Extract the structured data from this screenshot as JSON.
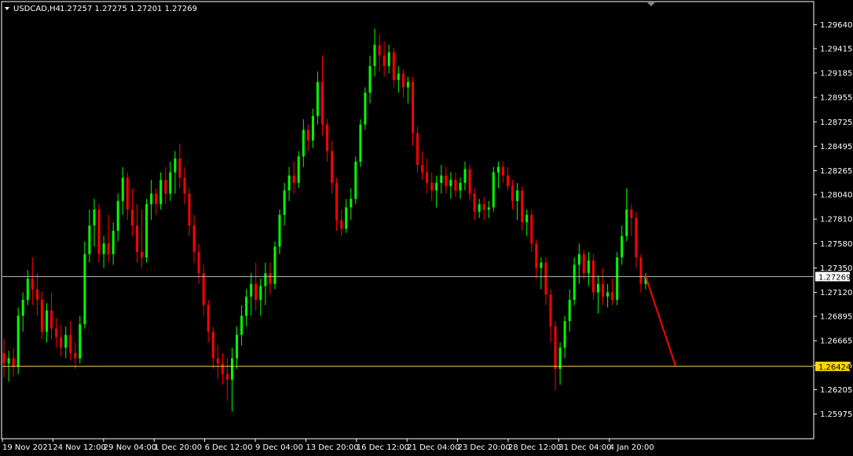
{
  "header": {
    "symbol": "USDCAD,H4",
    "ohlc": "1.27257 1.27275 1.27201 1.27269"
  },
  "colors": {
    "background": "#000000",
    "frame": "#ffffff",
    "bull": "#00ff00",
    "bear": "#ff0000",
    "price_line": "#c0c0c0",
    "support_line": "#ffd75a",
    "support_tag": "#ffd700",
    "arrow": "#ff0000"
  },
  "chart_data": {
    "type": "candlestick",
    "title": "USDCAD,H4",
    "ylim": [
      1.2575,
      1.2985
    ],
    "y_ticks": [
      "1.29640",
      "1.29415",
      "1.29185",
      "1.28955",
      "1.28725",
      "1.28495",
      "1.28265",
      "1.28040",
      "1.27810",
      "1.27580",
      "1.27350",
      "1.27120",
      "1.26895",
      "1.26665",
      "1.26435",
      "1.26205",
      "1.25975"
    ],
    "x_ticks": [
      "19 Nov 2021",
      "24 Nov 12:00",
      "29 Nov 04:00",
      "1 Dec 20:00",
      "6 Dec 12:00",
      "9 Dec 04:00",
      "13 Dec 20:00",
      "16 Dec 12:00",
      "21 Dec 04:00",
      "23 Dec 20:00",
      "28 Dec 12:00",
      "31 Dec 04:00",
      "4 Jan 20:00"
    ],
    "current_price": {
      "value": 1.27269,
      "label": "1.27269"
    },
    "support_level": {
      "value": 1.26424,
      "label": "1.26424"
    },
    "forecast_arrow": {
      "from": 1.2727,
      "to": 1.2643
    },
    "series": [
      {
        "o": 1.2655,
        "h": 1.2668,
        "l": 1.2632,
        "c": 1.2645
      },
      {
        "o": 1.2645,
        "h": 1.2657,
        "l": 1.2628,
        "c": 1.265
      },
      {
        "o": 1.265,
        "h": 1.266,
        "l": 1.2633,
        "c": 1.2642
      },
      {
        "o": 1.2642,
        "h": 1.2698,
        "l": 1.2635,
        "c": 1.269
      },
      {
        "o": 1.269,
        "h": 1.2712,
        "l": 1.2675,
        "c": 1.2705
      },
      {
        "o": 1.2705,
        "h": 1.2733,
        "l": 1.27,
        "c": 1.2725
      },
      {
        "o": 1.2725,
        "h": 1.2745,
        "l": 1.27,
        "c": 1.2715
      },
      {
        "o": 1.2715,
        "h": 1.273,
        "l": 1.269,
        "c": 1.2705
      },
      {
        "o": 1.2705,
        "h": 1.2713,
        "l": 1.2668,
        "c": 1.2675
      },
      {
        "o": 1.2675,
        "h": 1.2702,
        "l": 1.2665,
        "c": 1.2695
      },
      {
        "o": 1.2695,
        "h": 1.2712,
        "l": 1.2668,
        "c": 1.2678
      },
      {
        "o": 1.2678,
        "h": 1.2688,
        "l": 1.266,
        "c": 1.267
      },
      {
        "o": 1.267,
        "h": 1.2682,
        "l": 1.2652,
        "c": 1.266
      },
      {
        "o": 1.266,
        "h": 1.268,
        "l": 1.265,
        "c": 1.2672
      },
      {
        "o": 1.2672,
        "h": 1.2685,
        "l": 1.2648,
        "c": 1.2655
      },
      {
        "o": 1.2655,
        "h": 1.2665,
        "l": 1.264,
        "c": 1.265
      },
      {
        "o": 1.265,
        "h": 1.269,
        "l": 1.2645,
        "c": 1.2682
      },
      {
        "o": 1.2682,
        "h": 1.276,
        "l": 1.2678,
        "c": 1.2748
      },
      {
        "o": 1.2748,
        "h": 1.279,
        "l": 1.274,
        "c": 1.2775
      },
      {
        "o": 1.2775,
        "h": 1.28,
        "l": 1.2755,
        "c": 1.279
      },
      {
        "o": 1.279,
        "h": 1.2795,
        "l": 1.274,
        "c": 1.2748
      },
      {
        "o": 1.2748,
        "h": 1.2765,
        "l": 1.2735,
        "c": 1.2758
      },
      {
        "o": 1.2758,
        "h": 1.2785,
        "l": 1.274,
        "c": 1.2748
      },
      {
        "o": 1.2748,
        "h": 1.2778,
        "l": 1.2738,
        "c": 1.277
      },
      {
        "o": 1.277,
        "h": 1.2805,
        "l": 1.276,
        "c": 1.2798
      },
      {
        "o": 1.2798,
        "h": 1.283,
        "l": 1.2785,
        "c": 1.282
      },
      {
        "o": 1.282,
        "h": 1.2825,
        "l": 1.278,
        "c": 1.279
      },
      {
        "o": 1.279,
        "h": 1.281,
        "l": 1.2765,
        "c": 1.2775
      },
      {
        "o": 1.2775,
        "h": 1.2795,
        "l": 1.274,
        "c": 1.275
      },
      {
        "o": 1.275,
        "h": 1.279,
        "l": 1.2735,
        "c": 1.2745
      },
      {
        "o": 1.2745,
        "h": 1.28,
        "l": 1.274,
        "c": 1.2795
      },
      {
        "o": 1.2795,
        "h": 1.2818,
        "l": 1.278,
        "c": 1.2805
      },
      {
        "o": 1.2805,
        "h": 1.281,
        "l": 1.2785,
        "c": 1.2795
      },
      {
        "o": 1.2795,
        "h": 1.2825,
        "l": 1.279,
        "c": 1.2818
      },
      {
        "o": 1.2818,
        "h": 1.283,
        "l": 1.2795,
        "c": 1.2805
      },
      {
        "o": 1.2805,
        "h": 1.2835,
        "l": 1.2798,
        "c": 1.2825
      },
      {
        "o": 1.2825,
        "h": 1.2845,
        "l": 1.2805,
        "c": 1.2838
      },
      {
        "o": 1.2838,
        "h": 1.2852,
        "l": 1.281,
        "c": 1.282
      },
      {
        "o": 1.282,
        "h": 1.283,
        "l": 1.2795,
        "c": 1.2805
      },
      {
        "o": 1.2805,
        "h": 1.281,
        "l": 1.2765,
        "c": 1.2775
      },
      {
        "o": 1.2775,
        "h": 1.2785,
        "l": 1.274,
        "c": 1.275
      },
      {
        "o": 1.275,
        "h": 1.2758,
        "l": 1.272,
        "c": 1.273
      },
      {
        "o": 1.273,
        "h": 1.2738,
        "l": 1.269,
        "c": 1.27
      },
      {
        "o": 1.27,
        "h": 1.2705,
        "l": 1.2665,
        "c": 1.2675
      },
      {
        "o": 1.2675,
        "h": 1.268,
        "l": 1.264,
        "c": 1.265
      },
      {
        "o": 1.265,
        "h": 1.2662,
        "l": 1.263,
        "c": 1.2645
      },
      {
        "o": 1.2645,
        "h": 1.2655,
        "l": 1.2625,
        "c": 1.2635
      },
      {
        "o": 1.2635,
        "h": 1.265,
        "l": 1.261,
        "c": 1.263
      },
      {
        "o": 1.263,
        "h": 1.266,
        "l": 1.26,
        "c": 1.265
      },
      {
        "o": 1.265,
        "h": 1.268,
        "l": 1.264,
        "c": 1.2672
      },
      {
        "o": 1.2672,
        "h": 1.27,
        "l": 1.2662,
        "c": 1.269
      },
      {
        "o": 1.269,
        "h": 1.2715,
        "l": 1.268,
        "c": 1.2708
      },
      {
        "o": 1.2708,
        "h": 1.273,
        "l": 1.269,
        "c": 1.272
      },
      {
        "o": 1.272,
        "h": 1.274,
        "l": 1.2695,
        "c": 1.2705
      },
      {
        "o": 1.2705,
        "h": 1.2725,
        "l": 1.269,
        "c": 1.2718
      },
      {
        "o": 1.2718,
        "h": 1.274,
        "l": 1.27,
        "c": 1.273
      },
      {
        "o": 1.273,
        "h": 1.274,
        "l": 1.271,
        "c": 1.272
      },
      {
        "o": 1.272,
        "h": 1.276,
        "l": 1.2715,
        "c": 1.2755
      },
      {
        "o": 1.2755,
        "h": 1.279,
        "l": 1.2748,
        "c": 1.2785
      },
      {
        "o": 1.2785,
        "h": 1.2815,
        "l": 1.2775,
        "c": 1.2808
      },
      {
        "o": 1.2808,
        "h": 1.283,
        "l": 1.2798,
        "c": 1.2822
      },
      {
        "o": 1.2822,
        "h": 1.2835,
        "l": 1.2805,
        "c": 1.2815
      },
      {
        "o": 1.2815,
        "h": 1.2845,
        "l": 1.281,
        "c": 1.284
      },
      {
        "o": 1.284,
        "h": 1.2875,
        "l": 1.283,
        "c": 1.2865
      },
      {
        "o": 1.2865,
        "h": 1.287,
        "l": 1.2845,
        "c": 1.2855
      },
      {
        "o": 1.2855,
        "h": 1.2885,
        "l": 1.2848,
        "c": 1.2878
      },
      {
        "o": 1.2878,
        "h": 1.292,
        "l": 1.287,
        "c": 1.291
      },
      {
        "o": 1.291,
        "h": 1.2935,
        "l": 1.286,
        "c": 1.287
      },
      {
        "o": 1.287,
        "h": 1.2875,
        "l": 1.2835,
        "c": 1.2845
      },
      {
        "o": 1.2845,
        "h": 1.2855,
        "l": 1.2805,
        "c": 1.2815
      },
      {
        "o": 1.2815,
        "h": 1.282,
        "l": 1.277,
        "c": 1.278
      },
      {
        "o": 1.278,
        "h": 1.279,
        "l": 1.2765,
        "c": 1.2772
      },
      {
        "o": 1.2772,
        "h": 1.28,
        "l": 1.2768,
        "c": 1.2792
      },
      {
        "o": 1.2792,
        "h": 1.281,
        "l": 1.278,
        "c": 1.28
      },
      {
        "o": 1.28,
        "h": 1.284,
        "l": 1.2795,
        "c": 1.2835
      },
      {
        "o": 1.2835,
        "h": 1.2875,
        "l": 1.283,
        "c": 1.287
      },
      {
        "o": 1.287,
        "h": 1.2905,
        "l": 1.2865,
        "c": 1.29
      },
      {
        "o": 1.29,
        "h": 1.2935,
        "l": 1.289,
        "c": 1.2925
      },
      {
        "o": 1.2925,
        "h": 1.296,
        "l": 1.2915,
        "c": 1.2945
      },
      {
        "o": 1.2945,
        "h": 1.2955,
        "l": 1.292,
        "c": 1.2935
      },
      {
        "o": 1.2935,
        "h": 1.2948,
        "l": 1.2915,
        "c": 1.2925
      },
      {
        "o": 1.2925,
        "h": 1.2945,
        "l": 1.2918,
        "c": 1.2938
      },
      {
        "o": 1.2938,
        "h": 1.2942,
        "l": 1.2905,
        "c": 1.2912
      },
      {
        "o": 1.2912,
        "h": 1.2925,
        "l": 1.29,
        "c": 1.2918
      },
      {
        "o": 1.2918,
        "h": 1.2922,
        "l": 1.2895,
        "c": 1.2905
      },
      {
        "o": 1.2905,
        "h": 1.2915,
        "l": 1.289,
        "c": 1.291
      },
      {
        "o": 1.291,
        "h": 1.2915,
        "l": 1.285,
        "c": 1.2862
      },
      {
        "o": 1.2862,
        "h": 1.2868,
        "l": 1.2825,
        "c": 1.2832
      },
      {
        "o": 1.2832,
        "h": 1.2845,
        "l": 1.2818,
        "c": 1.2825
      },
      {
        "o": 1.2825,
        "h": 1.2838,
        "l": 1.2805,
        "c": 1.2815
      },
      {
        "o": 1.2815,
        "h": 1.2825,
        "l": 1.2798,
        "c": 1.2808
      },
      {
        "o": 1.2808,
        "h": 1.2822,
        "l": 1.2792,
        "c": 1.2815
      },
      {
        "o": 1.2815,
        "h": 1.2832,
        "l": 1.2805,
        "c": 1.2822
      },
      {
        "o": 1.2822,
        "h": 1.283,
        "l": 1.2805,
        "c": 1.2812
      },
      {
        "o": 1.2812,
        "h": 1.2825,
        "l": 1.28,
        "c": 1.2818
      },
      {
        "o": 1.2818,
        "h": 1.2825,
        "l": 1.2802,
        "c": 1.2808
      },
      {
        "o": 1.2808,
        "h": 1.282,
        "l": 1.28,
        "c": 1.2815
      },
      {
        "o": 1.2815,
        "h": 1.2835,
        "l": 1.2808,
        "c": 1.2828
      },
      {
        "o": 1.2828,
        "h": 1.2832,
        "l": 1.2798,
        "c": 1.2805
      },
      {
        "o": 1.2805,
        "h": 1.281,
        "l": 1.278,
        "c": 1.2788
      },
      {
        "o": 1.2788,
        "h": 1.28,
        "l": 1.2782,
        "c": 1.2795
      },
      {
        "o": 1.2795,
        "h": 1.2802,
        "l": 1.278,
        "c": 1.279
      },
      {
        "o": 1.279,
        "h": 1.2798,
        "l": 1.2782,
        "c": 1.2792
      },
      {
        "o": 1.2792,
        "h": 1.283,
        "l": 1.2788,
        "c": 1.2825
      },
      {
        "o": 1.2825,
        "h": 1.2835,
        "l": 1.281,
        "c": 1.283
      },
      {
        "o": 1.283,
        "h": 1.2835,
        "l": 1.2815,
        "c": 1.2822
      },
      {
        "o": 1.2822,
        "h": 1.283,
        "l": 1.2808,
        "c": 1.2812
      },
      {
        "o": 1.2812,
        "h": 1.2818,
        "l": 1.279,
        "c": 1.2798
      },
      {
        "o": 1.2798,
        "h": 1.2815,
        "l": 1.278,
        "c": 1.2808
      },
      {
        "o": 1.2808,
        "h": 1.2812,
        "l": 1.277,
        "c": 1.2778
      },
      {
        "o": 1.2778,
        "h": 1.279,
        "l": 1.2765,
        "c": 1.2785
      },
      {
        "o": 1.2785,
        "h": 1.279,
        "l": 1.275,
        "c": 1.2758
      },
      {
        "o": 1.2758,
        "h": 1.2762,
        "l": 1.2725,
        "c": 1.2735
      },
      {
        "o": 1.2735,
        "h": 1.2745,
        "l": 1.2715,
        "c": 1.274
      },
      {
        "o": 1.274,
        "h": 1.2745,
        "l": 1.27,
        "c": 1.271
      },
      {
        "o": 1.271,
        "h": 1.2715,
        "l": 1.2665,
        "c": 1.268
      },
      {
        "o": 1.268,
        "h": 1.2685,
        "l": 1.262,
        "c": 1.264
      },
      {
        "o": 1.264,
        "h": 1.2665,
        "l": 1.2625,
        "c": 1.266
      },
      {
        "o": 1.266,
        "h": 1.269,
        "l": 1.265,
        "c": 1.2685
      },
      {
        "o": 1.2685,
        "h": 1.2715,
        "l": 1.2675,
        "c": 1.2705
      },
      {
        "o": 1.2705,
        "h": 1.2745,
        "l": 1.27,
        "c": 1.2738
      },
      {
        "o": 1.2738,
        "h": 1.2758,
        "l": 1.272,
        "c": 1.2748
      },
      {
        "o": 1.2748,
        "h": 1.2752,
        "l": 1.2725,
        "c": 1.273
      },
      {
        "o": 1.273,
        "h": 1.275,
        "l": 1.2718,
        "c": 1.2742
      },
      {
        "o": 1.2742,
        "h": 1.2748,
        "l": 1.2705,
        "c": 1.2712
      },
      {
        "o": 1.2712,
        "h": 1.2728,
        "l": 1.2692,
        "c": 1.272
      },
      {
        "o": 1.272,
        "h": 1.2735,
        "l": 1.27,
        "c": 1.2708
      },
      {
        "o": 1.2708,
        "h": 1.272,
        "l": 1.2698,
        "c": 1.2712
      },
      {
        "o": 1.2712,
        "h": 1.2725,
        "l": 1.27,
        "c": 1.2705
      },
      {
        "o": 1.2705,
        "h": 1.275,
        "l": 1.27,
        "c": 1.2745
      },
      {
        "o": 1.2745,
        "h": 1.2775,
        "l": 1.2738,
        "c": 1.2765
      },
      {
        "o": 1.2765,
        "h": 1.281,
        "l": 1.276,
        "c": 1.279
      },
      {
        "o": 1.279,
        "h": 1.2795,
        "l": 1.2765,
        "c": 1.2782
      },
      {
        "o": 1.2782,
        "h": 1.2788,
        "l": 1.2735,
        "c": 1.2745
      },
      {
        "o": 1.2745,
        "h": 1.2748,
        "l": 1.2712,
        "c": 1.272
      },
      {
        "o": 1.272,
        "h": 1.273,
        "l": 1.2715,
        "c": 1.2727
      }
    ]
  }
}
